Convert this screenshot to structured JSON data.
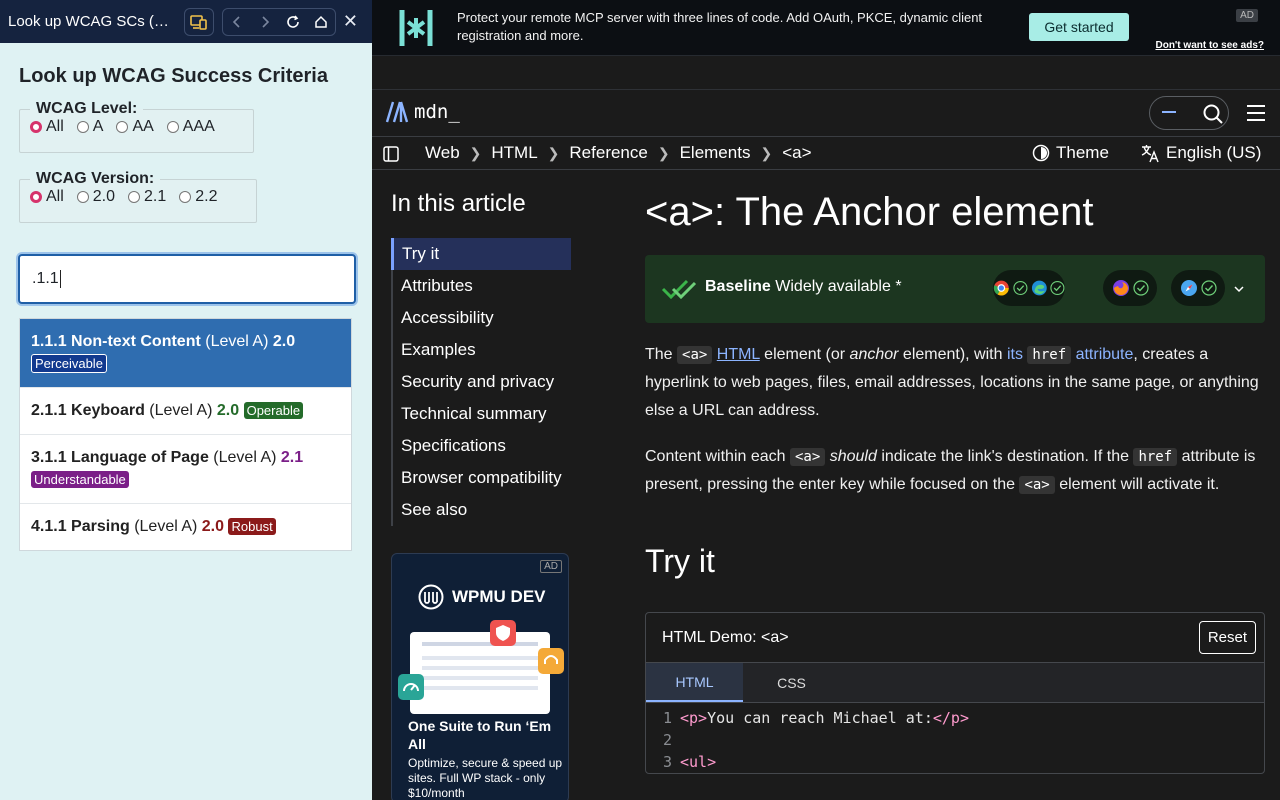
{
  "panel": {
    "window_title": "Look up WCAG SCs (WCA…",
    "heading": "Look up WCAG Success Criteria",
    "level_legend": "WCAG Level:",
    "level_options": [
      {
        "label": "All",
        "checked": true
      },
      {
        "label": "A",
        "checked": false
      },
      {
        "label": "AA",
        "checked": false
      },
      {
        "label": "AAA",
        "checked": false
      }
    ],
    "version_legend": "WCAG Version:",
    "version_options": [
      {
        "label": "All",
        "checked": true
      },
      {
        "label": "2.0",
        "checked": false
      },
      {
        "label": "2.1",
        "checked": false
      },
      {
        "label": "2.2",
        "checked": false
      }
    ],
    "search_value": ".1.1",
    "results": [
      {
        "id": "1.1.1",
        "name": "Non-text Content",
        "level": "(Level A)",
        "version": "2.0",
        "principle": "Perceivable",
        "selected": true,
        "color": "#123a8f"
      },
      {
        "id": "2.1.1",
        "name": "Keyboard",
        "level": "(Level A)",
        "version": "2.0",
        "principle": "Operable",
        "selected": false,
        "color": "#246b2a"
      },
      {
        "id": "3.1.1",
        "name": "Language of Page",
        "level": "(Level A)",
        "version": "2.1",
        "principle": "Understandable",
        "selected": false,
        "color": "#7b1f88"
      },
      {
        "id": "4.1.1",
        "name": "Parsing",
        "level": "(Level A)",
        "version": "2.0",
        "principle": "Robust",
        "selected": false,
        "color": "#8b1a1a"
      }
    ]
  },
  "ad": {
    "text": "Protect your remote MCP server with three lines of code. Add OAuth, PKCE, dynamic client registration and more.",
    "cta": "Get started",
    "badge": "AD",
    "hide": "Don't want to see ads?"
  },
  "mdn": {
    "logo_text": "mdn_",
    "breadcrumbs": [
      "Web",
      "HTML",
      "Reference",
      "Elements",
      "<a>"
    ],
    "theme": "Theme",
    "language": "English (US)"
  },
  "toc": {
    "heading": "In this article",
    "items": [
      "Try it",
      "Attributes",
      "Accessibility",
      "Examples",
      "Security and privacy",
      "Technical summary",
      "Specifications",
      "Browser compatibility",
      "See also"
    ]
  },
  "adcard": {
    "badge": "AD",
    "brand": "WPMU DEV",
    "headline": "One Suite to Run ‘Em All",
    "sub": "Optimize, secure & speed up sites. Full WP stack - only $10/month"
  },
  "article": {
    "title": "<a>: The Anchor element",
    "baseline_bold": "Baseline",
    "baseline_rest": "Widely available *",
    "p1_a": "The ",
    "p1_code": "<a>",
    "p1_b": " ",
    "p1_link1": "HTML",
    "p1_c": " element (or ",
    "p1_em": "anchor",
    "p1_d": " element), with ",
    "p1_link2": "its",
    "p1_code2": "href",
    "p1_link3": "attribute",
    "p1_e": ", creates a hyperlink to web pages, files, email addresses, locations in the same page, or anything else a URL can address.",
    "p2_a": "Content within each ",
    "p2_code": "<a>",
    "p2_em": "should",
    "p2_b": " indicate the link's destination. If the ",
    "p2_code2": "href",
    "p2_c": " attribute is present, pressing the enter key while focused on the ",
    "p2_code3": "<a>",
    "p2_d": " element will activate it.",
    "tryit": "Try it",
    "demo_title": "HTML Demo: <a>",
    "reset": "Reset",
    "tabs": [
      "HTML",
      "CSS"
    ],
    "code": [
      {
        "n": "1",
        "pre": "<p>",
        "text": "You can reach Michael at:",
        "post": "</p>"
      },
      {
        "n": "2",
        "pre": "",
        "text": "",
        "post": ""
      },
      {
        "n": "3",
        "pre": "<ul>",
        "text": "",
        "post": ""
      }
    ]
  }
}
